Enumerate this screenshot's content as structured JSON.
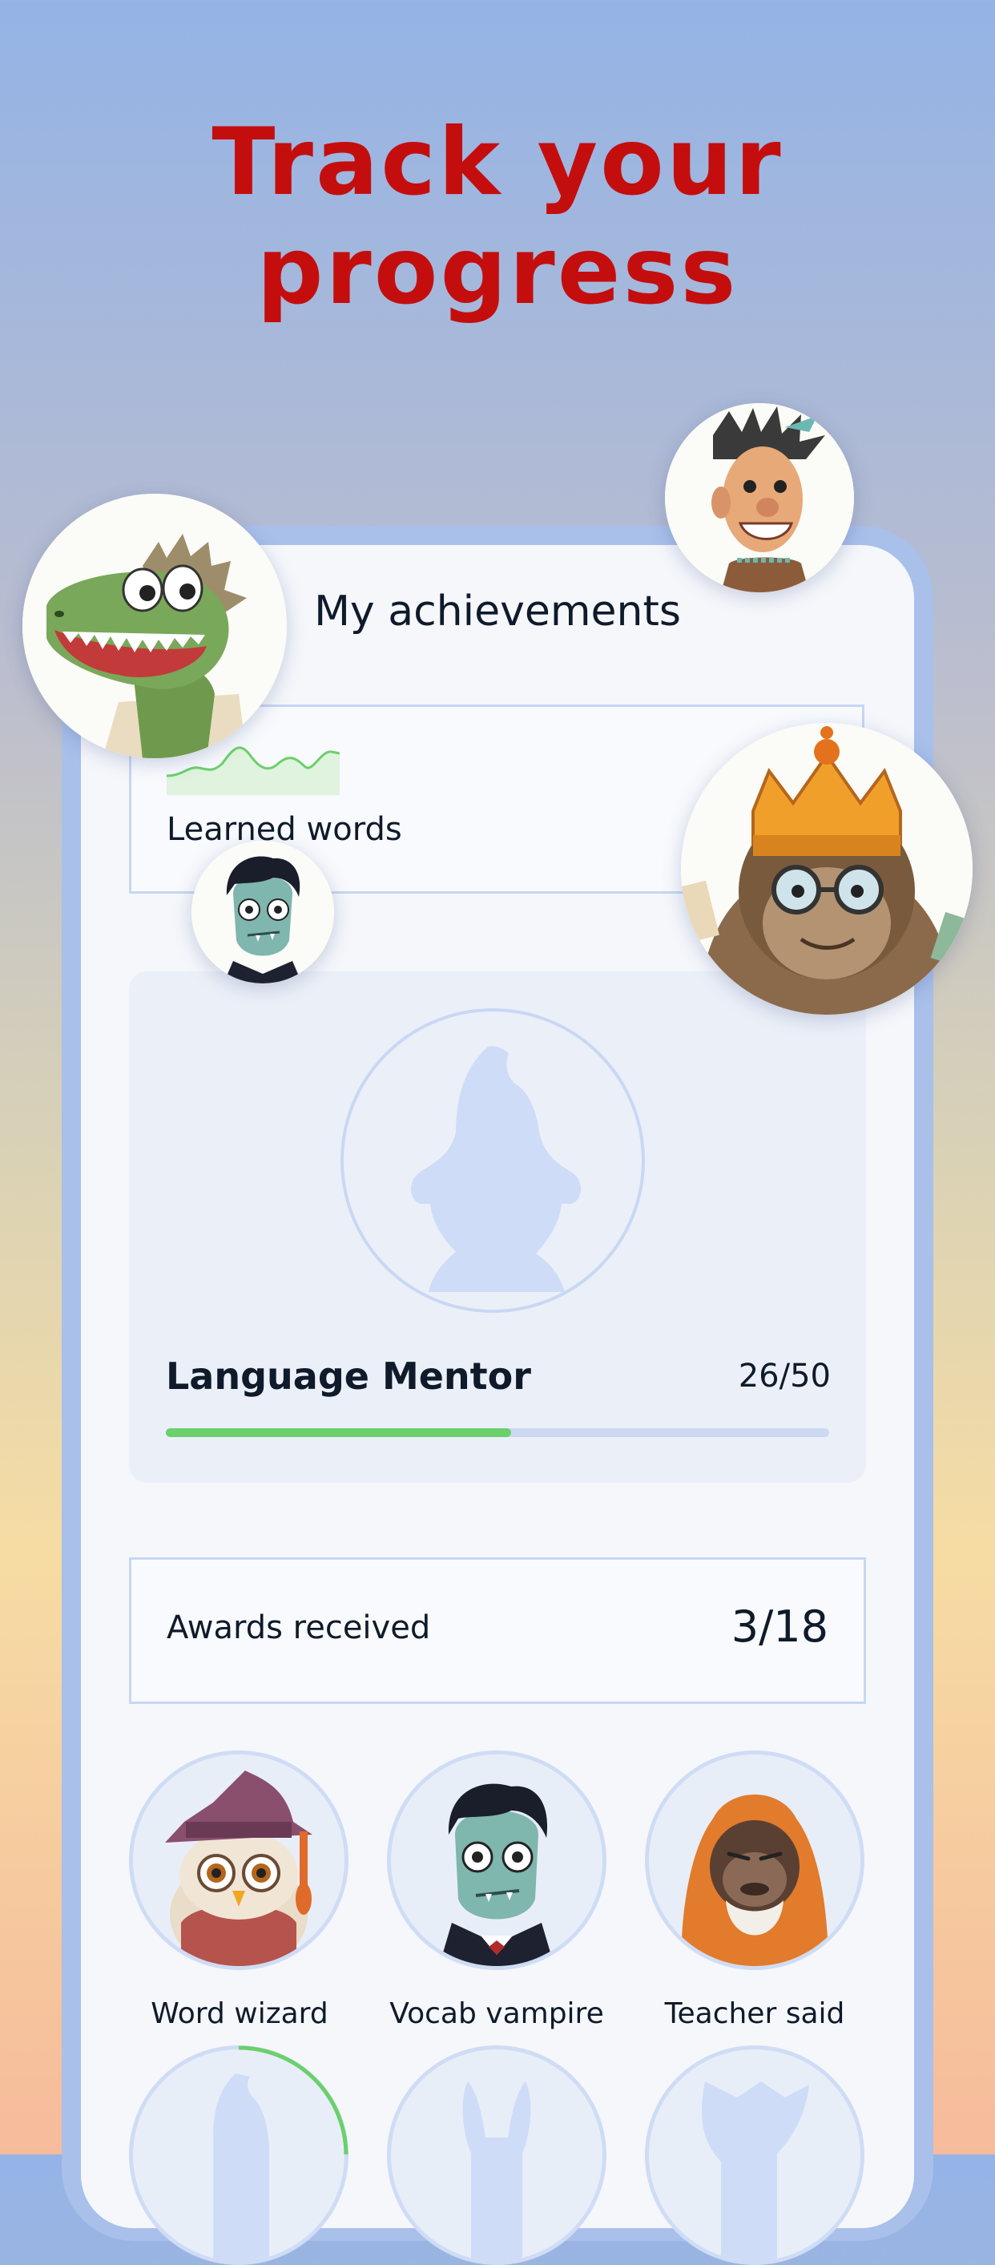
{
  "headline": {
    "line1": "Track your",
    "line2": "progress"
  },
  "screen": {
    "title": "My achievements"
  },
  "learned_words": {
    "label": "Learned words",
    "spark_color": "#6bd06b"
  },
  "mentor": {
    "name": "Language Mentor",
    "count": "26/50",
    "progress": 0.52,
    "progress_color": "#6bd06b"
  },
  "awards": {
    "label": "Awards received",
    "count": "3/18"
  },
  "badges": [
    {
      "label": "Word wizard",
      "icon": "owl-wizard-icon"
    },
    {
      "label": "Vocab vampire",
      "icon": "vampire-icon"
    },
    {
      "label": "Teacher said",
      "icon": "monk-ape-icon"
    }
  ],
  "locked_badges": [
    "gnome-silhouette-icon",
    "rabbit-silhouette-icon",
    "wolf-silhouette-icon"
  ],
  "floating_avatars": [
    "crocodile-avatar",
    "cave-man-avatar",
    "king-ape-avatar",
    "vampire-avatar"
  ],
  "colors": {
    "headline": "#c40e0e",
    "accent": "#6bd06b",
    "outline": "#c7d7f3"
  }
}
